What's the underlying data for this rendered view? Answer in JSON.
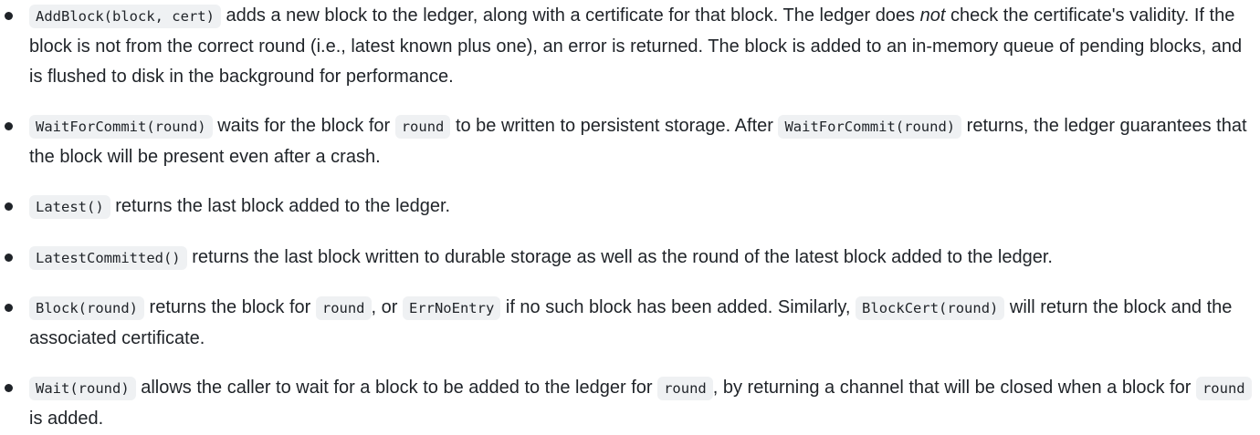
{
  "items": [
    {
      "code_1": "AddBlock(block, cert)",
      "text_1": " adds a new block to the ledger, along with a certificate for that block. The ledger does ",
      "emph": "not",
      "text_2": " check the certificate's validity. If the block is not from the correct round (i.e., latest known plus one), an error is returned. The block is added to an in-memory queue of pending blocks, and is flushed to disk in the background for performance."
    },
    {
      "code_1": "WaitForCommit(round)",
      "text_1": " waits for the block for ",
      "code_2": "round",
      "text_2": " to be written to persistent storage. After ",
      "code_3": "WaitForCommit(round)",
      "text_3": " returns, the ledger guarantees that the block will be present even after a crash."
    },
    {
      "code_1": "Latest()",
      "text_1": " returns the last block added to the ledger."
    },
    {
      "code_1": "LatestCommitted()",
      "text_1": " returns the last block written to durable storage as well as the round of the latest block added to the ledger."
    },
    {
      "code_1": "Block(round)",
      "text_1": " returns the block for ",
      "code_2": "round",
      "text_2": ", or ",
      "code_3": "ErrNoEntry",
      "text_3": " if no such block has been added. Similarly, ",
      "code_4": "BlockCert(round)",
      "text_4": " will return the block and the associated certificate."
    },
    {
      "code_1": "Wait(round)",
      "text_1": " allows the caller to wait for a block to be added to the ledger for ",
      "code_2": "round",
      "text_2": ", by returning a channel that will be closed when a block for ",
      "code_3": "round",
      "text_3": " is added."
    }
  ]
}
